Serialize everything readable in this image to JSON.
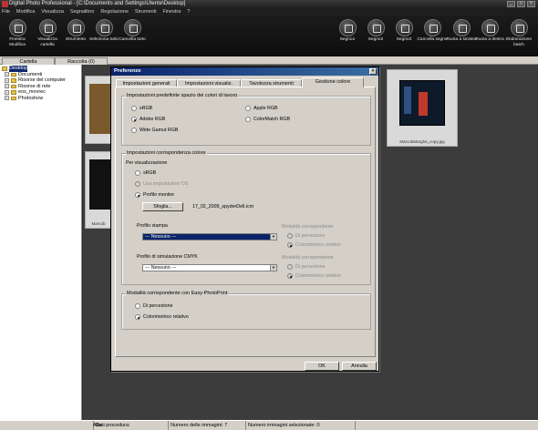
{
  "window": {
    "title": "Digital Photo Professional - [C:\\Documents and Settings\\Utente\\Desktop]"
  },
  "menu": [
    "File",
    "Modifica",
    "Visualizza",
    "Segnalibro",
    "Regolazione",
    "Strumenti",
    "Finestra",
    "?"
  ],
  "toolbar": {
    "left": [
      "Finestra Modifica",
      "Visualizza cartella",
      "Strumento",
      "Seleziona tutto",
      "Cancella tutto"
    ],
    "right": [
      "Segno1",
      "Segno2",
      "Segno3",
      "Cancella segno",
      "Ruota a sinistra",
      "Ruota a destra",
      "Elaborazione batch"
    ]
  },
  "tabs": [
    "Cartella",
    "Raccolta (0)"
  ],
  "tree": [
    {
      "label": "Desktop",
      "selected": true
    },
    {
      "label": "Documenti"
    },
    {
      "label": "Risorse del computer"
    },
    {
      "label": "Risorse di rete"
    },
    {
      "label": "eos_movrec"
    },
    {
      "label": "Photoshow"
    }
  ],
  "thumbnails": {
    "right_caption": "MarcobMargha_copy.jpg",
    "left_caption": "Marcob"
  },
  "dialog": {
    "title": "Preferenze",
    "tabs": [
      "Impostazioni generali",
      "Impostazioni visualiz.",
      "Tavolozza strumenti",
      "Gestione colore"
    ],
    "group1": {
      "title": "Impostazioni predefinite spazio dei colori di lavoro",
      "options": [
        "sRGB",
        "Adobe RGB",
        "Wide Gamut RGB",
        "Apple RGB",
        "ColorMatch RGB"
      ]
    },
    "group2": {
      "title": "Impostazioni corrispondenza colore",
      "per_vis": "Per visualizzazione",
      "opt_srgb": "sRGB",
      "opt_usa": "Usa impostazioni OS",
      "opt_profilo": "Profilo monitor",
      "browse": "Sfoglia...",
      "profile_file": "17_02_2009_spyderDell.icm",
      "stampa_label": "Profilo stampa",
      "stampa_value": "--- Nessuno ---",
      "cmyk_label": "Profilo di simulazione CMYK",
      "cmyk_value": "--- Nessuno ---",
      "mod_corr": "Modalità corrispondente",
      "di_perc": "Di percezione",
      "color_rel": "Colorimetrico relativo"
    },
    "group3": {
      "title": "Modalità corrispondente con Easy-PhotoPrint",
      "opt1": "Di percezione",
      "opt2": "Colorimetrico relativo"
    },
    "ok": "OK",
    "cancel": "Annulla"
  },
  "status": [
    "Alta qualità",
    "Dati procedura:",
    "Numero delle immagini: 7",
    "Numero immagini selezionate: 0"
  ]
}
